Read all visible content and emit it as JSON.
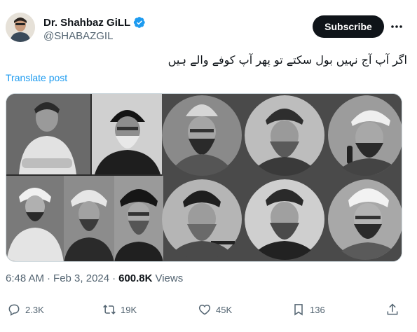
{
  "author": {
    "display_name": "Dr. Shahbaz GiLL",
    "handle": "@SHABAZGIL",
    "verified_icon": "verified-badge-icon",
    "verified_color": "#1d9bf0"
  },
  "header": {
    "subscribe_label": "Subscribe",
    "more_icon": "more-options-icon"
  },
  "tweet": {
    "text": "اگر آپ آج نہیں بول سکتے تو پھر آپ کوفے والے ہیں",
    "translate_label": "Translate post"
  },
  "meta": {
    "time": "6:48 AM",
    "separator": "·",
    "date": "Feb 3, 2024",
    "separator2": "·",
    "views_count": "600.8K",
    "views_label": "Views"
  },
  "actions": {
    "replies": "2.3K",
    "reposts": "19K",
    "likes": "45K",
    "bookmarks": "136"
  },
  "colors": {
    "text_primary": "#0f1419",
    "text_secondary": "#536471",
    "accent": "#1d9bf0"
  }
}
